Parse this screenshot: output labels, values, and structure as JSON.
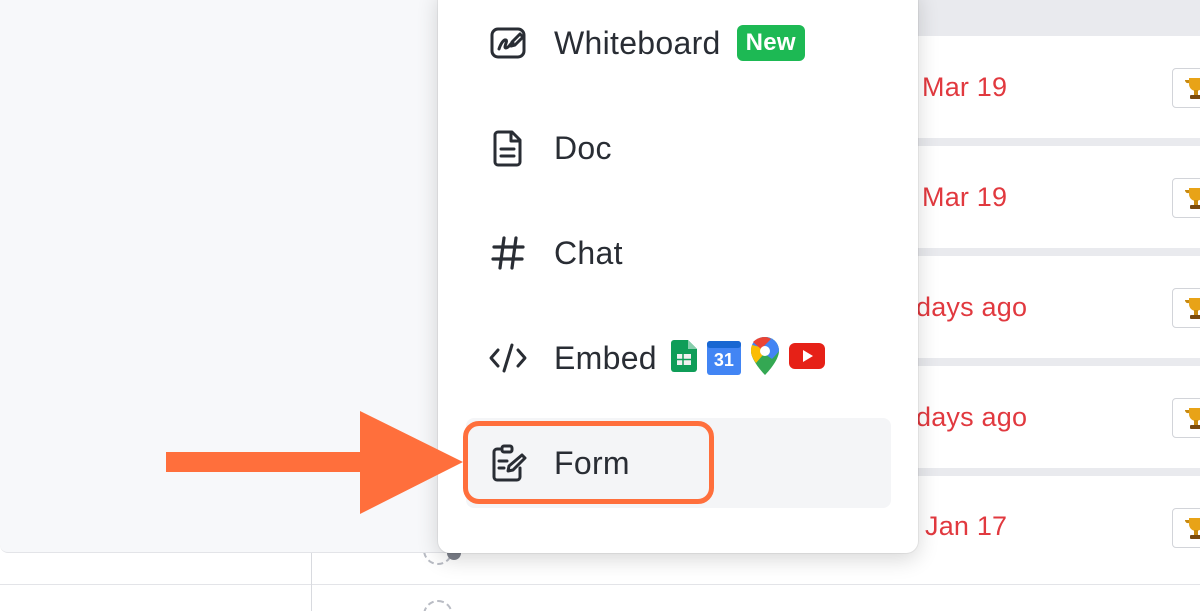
{
  "menu": {
    "items": [
      {
        "label": "Whiteboard",
        "icon": "whiteboard-icon",
        "badge": "New"
      },
      {
        "label": "Doc",
        "icon": "doc-icon"
      },
      {
        "label": "Chat",
        "icon": "hash-icon"
      },
      {
        "label": "Embed",
        "icon": "code-icon",
        "apps": [
          "google-sheets-icon",
          "google-calendar-icon",
          "google-maps-icon",
          "youtube-icon"
        ],
        "calendar_day": "31"
      },
      {
        "label": "Form",
        "icon": "form-icon",
        "highlighted": true
      }
    ]
  },
  "background_list": {
    "rows": [
      {
        "date": "Mar 19"
      },
      {
        "date": "Mar 19"
      },
      {
        "date": "days ago"
      },
      {
        "date": "days ago"
      },
      {
        "date": "Jan 17"
      }
    ]
  },
  "annotation": {
    "highlight_color": "#ff6f3c",
    "target": "Form"
  },
  "colors": {
    "accent_orange": "#ff6f3c",
    "date_red": "#e1393f",
    "badge_green": "#1db954"
  }
}
